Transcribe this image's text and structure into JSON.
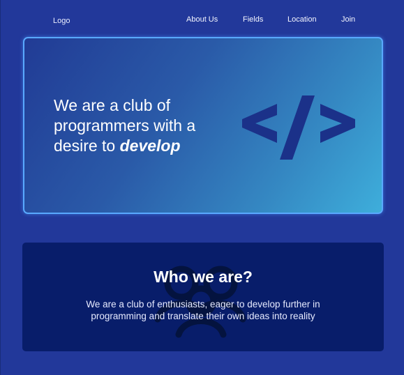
{
  "nav": {
    "logo": "Logo",
    "links": [
      {
        "label": "About Us"
      },
      {
        "label": "Fields"
      },
      {
        "label": "Location"
      },
      {
        "label": "Join"
      }
    ]
  },
  "hero": {
    "headline_prefix": "We are a club of programmers with a desire to ",
    "headline_emphasis": "develop",
    "icon": "code-icon",
    "colors": {
      "border": "#59a9ff",
      "gradient_start": "#213b95",
      "gradient_end": "#3eaedb",
      "icon": "#1b3189"
    }
  },
  "about": {
    "title": "Who we are?",
    "text": "We are a club of enthusiasts, eager to develop further in programming and translate their own ideas into reality",
    "icon": "people-icon",
    "colors": {
      "background": "#081d6a"
    }
  },
  "colors": {
    "page_background": "#22389a"
  }
}
